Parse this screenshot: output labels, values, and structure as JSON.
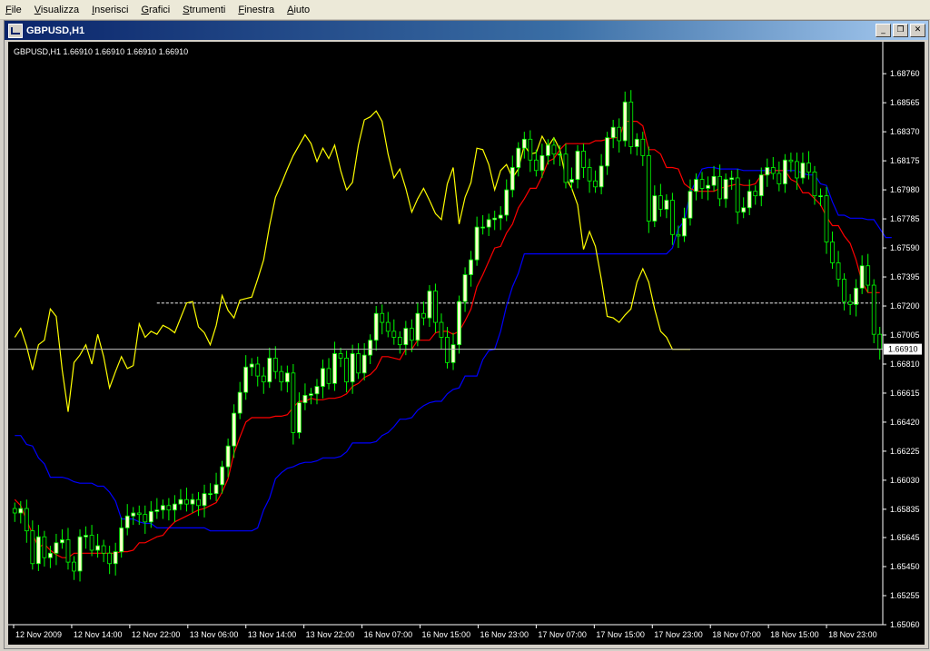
{
  "menu": {
    "items": [
      "File",
      "Visualizza",
      "Inserisci",
      "Grafici",
      "Strumenti",
      "Finestra",
      "Aiuto"
    ]
  },
  "window": {
    "title": "GBPUSD,H1",
    "minimize_glyph": "_",
    "restore_glyph": "❐",
    "close_glyph": "✕"
  },
  "chart_data": {
    "type": "candlestick",
    "symbol_label": "GBPUSD,H1  1.66910 1.66910 1.66910 1.66910",
    "ylim": [
      1.6506,
      1.6895
    ],
    "y_ticks": [
      {
        "value": 1.6876,
        "label": "1.68760"
      },
      {
        "value": 1.68565,
        "label": "1.68565"
      },
      {
        "value": 1.6837,
        "label": "1.68370"
      },
      {
        "value": 1.68175,
        "label": "1.68175"
      },
      {
        "value": 1.6798,
        "label": "1.67980"
      },
      {
        "value": 1.67785,
        "label": "1.67785"
      },
      {
        "value": 1.6759,
        "label": "1.67590"
      },
      {
        "value": 1.67395,
        "label": "1.67395"
      },
      {
        "value": 1.672,
        "label": "1.67200"
      },
      {
        "value": 1.67005,
        "label": "1.67005"
      },
      {
        "value": 1.6681,
        "label": "1.66810"
      },
      {
        "value": 1.66615,
        "label": "1.66615"
      },
      {
        "value": 1.6642,
        "label": "1.66420"
      },
      {
        "value": 1.66225,
        "label": "1.66225"
      },
      {
        "value": 1.6603,
        "label": "1.66030"
      },
      {
        "value": 1.65835,
        "label": "1.65835"
      },
      {
        "value": 1.65645,
        "label": "1.65645"
      },
      {
        "value": 1.6545,
        "label": "1.65450"
      },
      {
        "value": 1.65255,
        "label": "1.65255"
      },
      {
        "value": 1.6506,
        "label": "1.65060"
      }
    ],
    "x_labels": [
      "12 Nov 2009",
      "12 Nov 14:00",
      "12 Nov 22:00",
      "13 Nov 06:00",
      "13 Nov 14:00",
      "13 Nov 22:00",
      "16 Nov 07:00",
      "16 Nov 15:00",
      "16 Nov 23:00",
      "17 Nov 07:00",
      "17 Nov 15:00",
      "17 Nov 23:00",
      "18 Nov 07:00",
      "18 Nov 15:00",
      "18 Nov 23:00"
    ],
    "bar_count": 147,
    "current_price": 1.6691,
    "current_price_label": "1.66910",
    "colors": {
      "background": "#000000",
      "bull_body": "#ffffcc",
      "bear_body": "#000000",
      "wick": "#00ff00",
      "tenkan": "#ff0000",
      "kijun": "#0000ff",
      "chikou": "#ffff00",
      "cloud_bull": "#ffffff",
      "cloud_bear": "#90ee90",
      "price_line": "#c0c0c0",
      "axis_text": "#ffffff"
    },
    "series": {
      "close": [
        1.6581,
        1.6584,
        1.6569,
        1.6547,
        1.6565,
        1.6551,
        1.6554,
        1.6561,
        1.6563,
        1.6548,
        1.6542,
        1.6565,
        1.6566,
        1.6556,
        1.6559,
        1.6554,
        1.6547,
        1.6555,
        1.6571,
        1.6579,
        1.6581,
        1.658,
        1.6575,
        1.6582,
        1.6583,
        1.6586,
        1.6583,
        1.6587,
        1.659,
        1.6587,
        1.659,
        1.6586,
        1.6594,
        1.6594,
        1.66,
        1.6612,
        1.6626,
        1.6648,
        1.6662,
        1.6679,
        1.6681,
        1.6673,
        1.6669,
        1.6685,
        1.6676,
        1.6669,
        1.6675,
        1.6635,
        1.6655,
        1.666,
        1.6661,
        1.6666,
        1.6678,
        1.6668,
        1.6688,
        1.6685,
        1.6669,
        1.6688,
        1.6675,
        1.6687,
        1.6697,
        1.6715,
        1.6709,
        1.6703,
        1.6699,
        1.6694,
        1.6705,
        1.6697,
        1.6715,
        1.6712,
        1.673,
        1.6709,
        1.6699,
        1.6682,
        1.6694,
        1.6723,
        1.6741,
        1.6751,
        1.6773,
        1.6773,
        1.6778,
        1.6779,
        1.6781,
        1.6798,
        1.6813,
        1.6826,
        1.6832,
        1.6818,
        1.6811,
        1.6821,
        1.6828,
        1.6822,
        1.6822,
        1.6803,
        1.6805,
        1.6824,
        1.6813,
        1.6804,
        1.68,
        1.6814,
        1.6833,
        1.684,
        1.6831,
        1.6857,
        1.6827,
        1.6832,
        1.6821,
        1.6777,
        1.6794,
        1.6785,
        1.6791,
        1.6768,
        1.6767,
        1.6779,
        1.6797,
        1.6805,
        1.6799,
        1.6801,
        1.6807,
        1.6792,
        1.6805,
        1.6806,
        1.6783,
        1.6786,
        1.6797,
        1.6794,
        1.6808,
        1.6813,
        1.6809,
        1.6802,
        1.6818,
        1.6817,
        1.6806,
        1.6816,
        1.681,
        1.6794,
        1.6794,
        1.6763,
        1.6749,
        1.6738,
        1.6723,
        1.6721,
        1.6732,
        1.6747,
        1.6734,
        1.6701,
        1.6691
      ],
      "tenkan": [
        1.659,
        1.6586,
        1.6576,
        1.6567,
        1.6558,
        1.656,
        1.6556,
        1.6553,
        1.6551,
        1.6551,
        1.6554,
        1.6554,
        1.6554,
        1.6554,
        1.6554,
        1.6554,
        1.6554,
        1.6554,
        1.6555,
        1.6555,
        1.6556,
        1.6561,
        1.6561,
        1.6563,
        1.6565,
        1.6566,
        1.6571,
        1.6575,
        1.6577,
        1.6579,
        1.6581,
        1.6583,
        1.6584,
        1.6586,
        1.6588,
        1.6595,
        1.6604,
        1.6621,
        1.6632,
        1.6642,
        1.6645,
        1.6645,
        1.6645,
        1.6645,
        1.6646,
        1.6646,
        1.6647,
        1.6652,
        1.6656,
        1.6656,
        1.6658,
        1.6657,
        1.6657,
        1.6658,
        1.6658,
        1.6659,
        1.6661,
        1.6666,
        1.6668,
        1.6672,
        1.6674,
        1.6678,
        1.6686,
        1.6686,
        1.6685,
        1.6684,
        1.6691,
        1.6691,
        1.6697,
        1.6697,
        1.6697,
        1.6702,
        1.6703,
        1.6703,
        1.6701,
        1.6703,
        1.671,
        1.6718,
        1.6733,
        1.6741,
        1.675,
        1.6759,
        1.676,
        1.6769,
        1.6775,
        1.6786,
        1.6792,
        1.6799,
        1.6799,
        1.6807,
        1.6817,
        1.6819,
        1.6825,
        1.6829,
        1.6829,
        1.6829,
        1.6829,
        1.6829,
        1.6831,
        1.6831,
        1.6832,
        1.6833,
        1.6833,
        1.6844,
        1.6844,
        1.6844,
        1.6841,
        1.6825,
        1.6825,
        1.6822,
        1.6813,
        1.6813,
        1.6812,
        1.6802,
        1.6799,
        1.6797,
        1.6797,
        1.6797,
        1.6797,
        1.6799,
        1.68,
        1.6801,
        1.6802,
        1.6801,
        1.6801,
        1.6802,
        1.6808,
        1.6808,
        1.6811,
        1.6811,
        1.6811,
        1.6805,
        1.6803,
        1.6796,
        1.6796,
        1.6792,
        1.6788,
        1.678,
        1.6774,
        1.6774,
        1.6767,
        1.6762,
        1.6751,
        1.6736,
        1.6729,
        1.6729,
        1.6729
      ],
      "kijun": [
        1.6633,
        1.6633,
        1.6627,
        1.6626,
        1.6618,
        1.6614,
        1.6605,
        1.6605,
        1.6605,
        1.6604,
        1.6602,
        1.6601,
        1.6601,
        1.6601,
        1.6599,
        1.6599,
        1.6595,
        1.6589,
        1.6577,
        1.6577,
        1.6577,
        1.6575,
        1.6574,
        1.6574,
        1.6571,
        1.6571,
        1.6571,
        1.6571,
        1.6571,
        1.6571,
        1.6571,
        1.6571,
        1.6571,
        1.6569,
        1.6569,
        1.6569,
        1.6569,
        1.6569,
        1.6569,
        1.6569,
        1.6569,
        1.6571,
        1.6583,
        1.6591,
        1.6604,
        1.6608,
        1.6611,
        1.6612,
        1.6614,
        1.6615,
        1.6615,
        1.6616,
        1.6618,
        1.6618,
        1.6618,
        1.6619,
        1.6622,
        1.6628,
        1.6628,
        1.6628,
        1.6628,
        1.6629,
        1.6633,
        1.6635,
        1.6639,
        1.6644,
        1.6644,
        1.6645,
        1.665,
        1.6653,
        1.6655,
        1.6656,
        1.6656,
        1.6661,
        1.6664,
        1.6665,
        1.6673,
        1.6673,
        1.6673,
        1.6684,
        1.669,
        1.6691,
        1.6703,
        1.672,
        1.6733,
        1.6742,
        1.6755,
        1.6755,
        1.6755,
        1.6755,
        1.6755,
        1.6755,
        1.6755,
        1.6755,
        1.6755,
        1.6755,
        1.6755,
        1.6755,
        1.6755,
        1.6755,
        1.6755,
        1.6755,
        1.6755,
        1.6755,
        1.6755,
        1.6755,
        1.6755,
        1.6755,
        1.6755,
        1.6755,
        1.6755,
        1.6759,
        1.6772,
        1.6777,
        1.6796,
        1.6804,
        1.6812,
        1.6813,
        1.6813,
        1.6812,
        1.6812,
        1.6812,
        1.6812,
        1.6811,
        1.6811,
        1.6811,
        1.6811,
        1.6811,
        1.6811,
        1.6811,
        1.6811,
        1.6811,
        1.6811,
        1.6809,
        1.6808,
        1.6808,
        1.6802,
        1.6801,
        1.679,
        1.6781,
        1.6781,
        1.6779,
        1.6779,
        1.6779,
        1.6778,
        1.6778,
        1.6772,
        1.6766,
        1.6766
      ],
      "chikou": [
        1.6699,
        1.6705,
        1.6693,
        1.6677,
        1.6694,
        1.6697,
        1.6718,
        1.6713,
        1.6677,
        1.6649,
        1.6682,
        1.6687,
        1.6694,
        1.6681,
        1.6701,
        1.6686,
        1.6665,
        1.6676,
        1.6686,
        1.6678,
        1.668,
        1.6708,
        1.6699,
        1.6703,
        1.6701,
        1.6707,
        1.6705,
        1.6702,
        1.6712,
        1.6722,
        1.6723,
        1.6706,
        1.6702,
        1.6694,
        1.6707,
        1.6727,
        1.6717,
        1.6712,
        1.6724,
        1.6725,
        1.6726,
        1.6738,
        1.6751,
        1.6774,
        1.6793,
        1.6802,
        1.6812,
        1.6821,
        1.6828,
        1.6835,
        1.6829,
        1.6817,
        1.6826,
        1.6819,
        1.6828,
        1.6811,
        1.6798,
        1.6803,
        1.6828,
        1.6845,
        1.6847,
        1.6851,
        1.6844,
        1.6822,
        1.6806,
        1.6812,
        1.6799,
        1.6783,
        1.6792,
        1.6799,
        1.6791,
        1.6782,
        1.6778,
        1.6802,
        1.6813,
        1.6775,
        1.6793,
        1.6803,
        1.6826,
        1.6825,
        1.6815,
        1.6798,
        1.6811,
        1.6815,
        1.6806,
        1.6812,
        1.6828,
        1.6822,
        1.6823,
        1.6834,
        1.6827,
        1.6833,
        1.6825,
        1.6806,
        1.6799,
        1.6788,
        1.6758,
        1.677,
        1.676,
        1.6738,
        1.6713,
        1.6712,
        1.6709,
        1.6714,
        1.6718,
        1.6736,
        1.6745,
        1.6736,
        1.6718,
        1.6703,
        1.6699,
        1.6691,
        1.6691,
        1.6691,
        1.6691
      ]
    },
    "cloud": {
      "start_index": 0,
      "span_a": [
        1.6722,
        1.6722,
        1.6722,
        1.6722,
        1.6722,
        1.6722,
        1.6722,
        1.6722,
        1.6722,
        1.6722,
        1.6722,
        1.6722,
        1.6722,
        1.6722,
        1.6722,
        1.6722,
        1.6722,
        1.6722,
        1.6722,
        1.6722,
        1.6722,
        1.6722,
        1.6722,
        1.6722,
        1.6722,
        1.6722,
        1.6722,
        1.6722,
        1.6722,
        1.6722,
        1.6722,
        1.6722,
        1.6722,
        1.6722,
        1.6722,
        1.6722,
        1.6722,
        1.6722,
        1.6722,
        1.6722,
        1.6722,
        1.6722,
        1.6722,
        1.6722,
        1.6722,
        1.6722,
        1.6722,
        1.6722,
        1.6722,
        1.6722,
        1.6722,
        1.6722,
        1.6722,
        1.6722,
        1.6722,
        1.6722,
        1.6722,
        1.6722,
        1.6722,
        1.6722,
        1.6722,
        1.6722,
        1.6722,
        1.6722,
        1.6722,
        1.6722,
        1.6722,
        1.6722,
        1.6722,
        1.6722,
        1.6722,
        1.6722,
        1.6722,
        1.6722,
        1.6722,
        1.6722,
        1.6722,
        1.6722,
        1.6722,
        1.6722,
        1.6722,
        1.6722,
        1.6722,
        1.6722,
        1.6722,
        1.6722,
        1.6722,
        1.6722,
        1.6722,
        1.6722,
        1.6722,
        1.6722,
        1.6722,
        1.6722,
        1.6722,
        1.6722,
        1.6722,
        1.6722,
        1.6722,
        1.6722,
        1.6722,
        1.6722,
        1.6722,
        1.6722,
        1.6722,
        1.6722,
        1.6722,
        1.6722,
        1.6722,
        1.6722,
        1.6722,
        1.6722,
        1.6722,
        1.6722,
        1.6722,
        1.6722,
        1.6722,
        1.6722,
        1.6722,
        1.6722,
        1.6722,
        1.6722,
        1.6722,
        1.6722,
        1.6722,
        1.6722,
        1.6722,
        1.6722,
        1.6722,
        1.6722,
        1.6722,
        1.6722,
        1.6722,
        1.6722,
        1.6722,
        1.6722,
        1.6722,
        1.6722,
        1.6722,
        1.6722,
        1.6722,
        1.6722,
        1.6722,
        1.6722,
        1.6722,
        1.6722,
        1.6722
      ],
      "span_b": [
        1.6722,
        1.6722,
        1.6722,
        1.6722,
        1.6722,
        1.6722,
        1.6722,
        1.6722,
        1.6722,
        1.6722,
        1.6722,
        1.6722,
        1.6722,
        1.6722,
        1.6722,
        1.6722,
        1.6722,
        1.6722,
        1.6722,
        1.6722,
        1.6722,
        1.6722,
        1.6722,
        1.6722,
        1.6722,
        1.6722,
        1.6722,
        1.6722,
        1.6722,
        1.6722,
        1.6722,
        1.6722,
        1.6722,
        1.6722,
        1.6722,
        1.6722,
        1.6722,
        1.6722,
        1.6722,
        1.6722,
        1.6722,
        1.6722,
        1.6722,
        1.6722,
        1.6722,
        1.6722,
        1.6722,
        1.6722,
        1.6722,
        1.6722,
        1.6722,
        1.6722,
        1.6722,
        1.6722,
        1.6722,
        1.6722,
        1.6722,
        1.6722,
        1.6722,
        1.6722,
        1.6722,
        1.6722,
        1.6722,
        1.6722,
        1.6722,
        1.6722,
        1.6722,
        1.6722,
        1.6722,
        1.6722,
        1.6722,
        1.6722,
        1.6722,
        1.6722,
        1.6722,
        1.6722,
        1.6722,
        1.6722,
        1.6722,
        1.6722,
        1.6722,
        1.6722,
        1.6722,
        1.6722,
        1.6722,
        1.6722,
        1.6722,
        1.6722,
        1.6722,
        1.6722,
        1.6722,
        1.6722,
        1.6722,
        1.6722,
        1.6722,
        1.6722,
        1.6722,
        1.6722,
        1.6722,
        1.6722,
        1.6722,
        1.6722,
        1.6722,
        1.6722,
        1.6722,
        1.6722,
        1.6722,
        1.6722,
        1.6722,
        1.6722,
        1.6722,
        1.6722,
        1.6722,
        1.6722,
        1.6722,
        1.6722,
        1.6722,
        1.6722,
        1.6722,
        1.6722,
        1.6722,
        1.6722,
        1.6722,
        1.6722,
        1.6722,
        1.6722,
        1.6722,
        1.6722,
        1.6722,
        1.6722,
        1.6722,
        1.6722,
        1.6722,
        1.6722,
        1.6722,
        1.6722,
        1.6722,
        1.6722,
        1.6722,
        1.6722,
        1.6722,
        1.6722,
        1.6722,
        1.6722,
        1.6722,
        1.6722,
        1.6722
      ]
    }
  }
}
